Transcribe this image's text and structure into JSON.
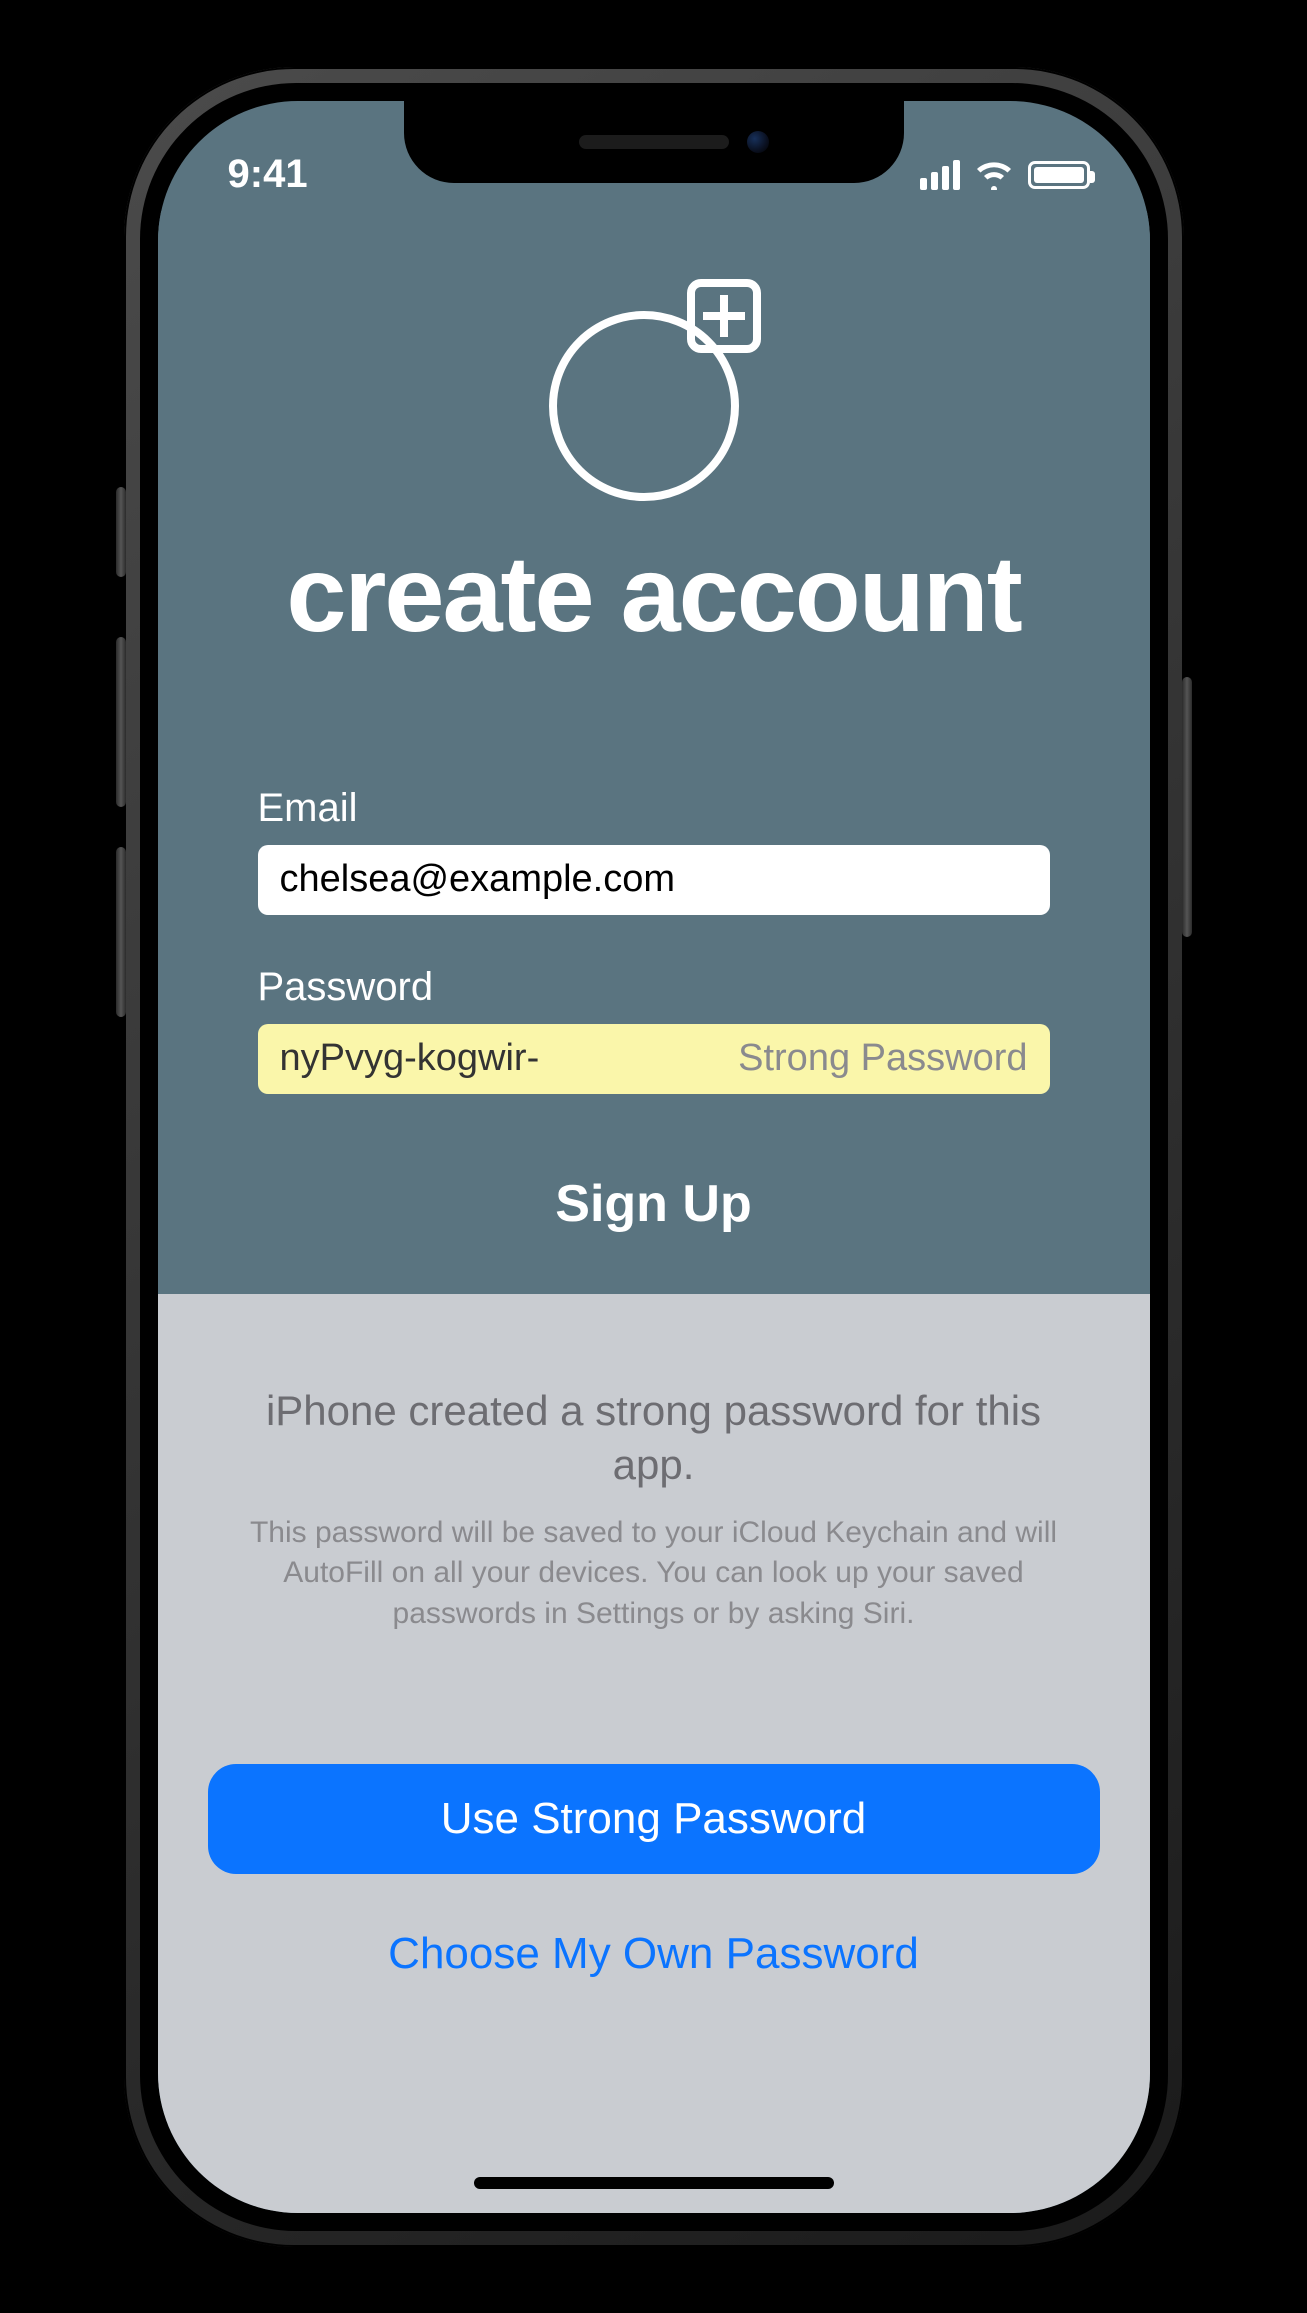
{
  "status": {
    "time": "9:41"
  },
  "header": {
    "title": "create account"
  },
  "form": {
    "email_label": "Email",
    "email_value": "chelsea@example.com",
    "password_label": "Password",
    "password_value": "nyPvyg-kogwir-",
    "password_strength": "Strong Password",
    "submit_label": "Sign Up"
  },
  "sheet": {
    "title": "iPhone created a strong password for this app.",
    "subtitle": "This password will be saved to your iCloud Keychain and will AutoFill on all your devices. You can look up your saved passwords in Settings or by asking Siri.",
    "primary_label": "Use Strong Password",
    "secondary_label": "Choose My Own Password"
  }
}
